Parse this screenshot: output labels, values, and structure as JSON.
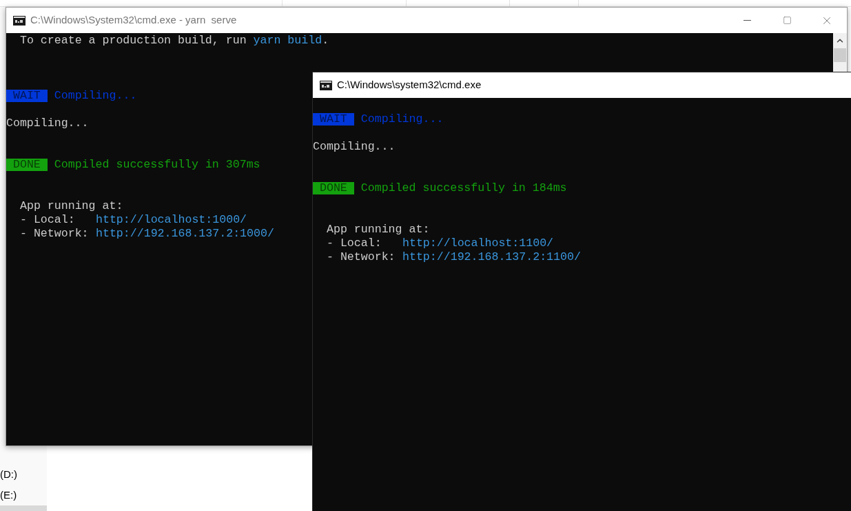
{
  "explorer": {
    "sidebar": {
      "items": [
        {
          "label": "(D:)",
          "selected": false
        },
        {
          "label": "(E:)",
          "selected": false
        },
        {
          "selected": true
        }
      ]
    }
  },
  "windows": [
    {
      "title": "C:\\Windows\\System32\\cmd.exe - yarn  serve",
      "active": false,
      "lines": [
        {
          "kind": "output",
          "indent": true,
          "segments": [
            {
              "text": "To create a production build, run "
            },
            {
              "text": "yarn build",
              "color": "#3a96dd"
            },
            {
              "text": "."
            }
          ]
        },
        {
          "kind": "blank"
        },
        {
          "kind": "blank"
        },
        {
          "kind": "blank"
        },
        {
          "kind": "status",
          "badge": "WAIT",
          "message": "Compiling...",
          "color": "#0037da"
        },
        {
          "kind": "blank"
        },
        {
          "kind": "output",
          "indent": false,
          "segments": [
            {
              "text": "Compiling...",
              "color": "#cccccc"
            }
          ]
        },
        {
          "kind": "blank"
        },
        {
          "kind": "blank"
        },
        {
          "kind": "status",
          "badge": "DONE",
          "message": "Compiled successfully in 307ms",
          "color": "#13a10e"
        },
        {
          "kind": "blank"
        },
        {
          "kind": "blank"
        },
        {
          "kind": "output",
          "indent": true,
          "segments": [
            {
              "text": "App running at:",
              "color": "#cccccc"
            }
          ]
        },
        {
          "kind": "address",
          "label": "- Local:",
          "url": "http://localhost:1000/"
        },
        {
          "kind": "address",
          "label": "- Network:",
          "url": "http://192.168.137.2:1000/"
        }
      ]
    },
    {
      "title": "C:\\Windows\\system32\\cmd.exe",
      "active": true,
      "lines": [
        {
          "kind": "blank"
        },
        {
          "kind": "status",
          "badge": "WAIT",
          "message": "Compiling...",
          "color": "#0037da"
        },
        {
          "kind": "blank"
        },
        {
          "kind": "output",
          "indent": false,
          "segments": [
            {
              "text": "Compiling...",
              "color": "#cccccc"
            }
          ]
        },
        {
          "kind": "blank"
        },
        {
          "kind": "blank"
        },
        {
          "kind": "status",
          "badge": "DONE",
          "message": "Compiled successfully in 184ms",
          "color": "#13a10e"
        },
        {
          "kind": "blank"
        },
        {
          "kind": "blank"
        },
        {
          "kind": "output",
          "indent": true,
          "segments": [
            {
              "text": "App running at:",
              "color": "#cccccc"
            }
          ]
        },
        {
          "kind": "address",
          "label": "- Local:",
          "url": "http://localhost:1100/"
        },
        {
          "kind": "address",
          "label": "- Network:",
          "url": "http://192.168.137.2:1100/"
        }
      ]
    }
  ]
}
